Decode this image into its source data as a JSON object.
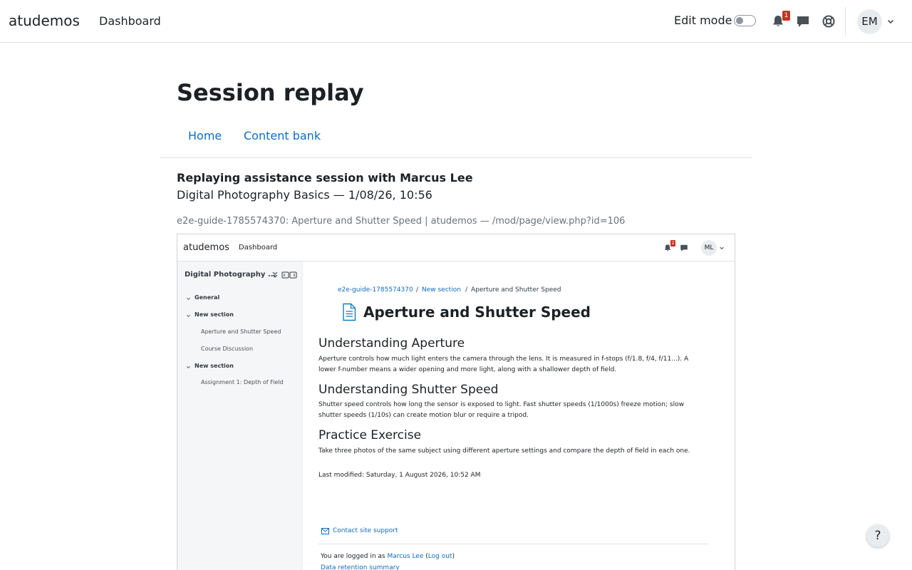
{
  "navbar": {
    "brand": "atudemos",
    "dashboard": "Dashboard",
    "edit_mode_label": "Edit mode",
    "notification_count": "1",
    "avatar_initials": "EM"
  },
  "page": {
    "title": "Session replay",
    "tabs": [
      {
        "label": "Home"
      },
      {
        "label": "Content bank"
      }
    ],
    "replay_heading": "Replaying assistance session with Marcus Lee",
    "replay_subheading": "Digital Photography Basics — 1/08/26, 10:56",
    "frame_caption": "e2e-guide-1785574370: Aperture and Shutter Speed | atudemos — /mod/page/view.php?id=106"
  },
  "frame": {
    "navbar": {
      "brand": "atudemos",
      "dashboard": "Dashboard",
      "notification_count": "2",
      "avatar_initials": "ML"
    },
    "sidebar": {
      "course_title": "Digital Photography ...",
      "sections": [
        {
          "label": "General"
        },
        {
          "label": "New section"
        },
        {
          "label": "New section"
        }
      ],
      "items": [
        {
          "label": "Aperture and Shutter Speed"
        },
        {
          "label": "Course Discussion"
        },
        {
          "label": "Assignment 1: Depth of Field"
        }
      ]
    },
    "breadcrumb": [
      "e2e-guide-1785574370",
      "New section",
      "Aperture and Shutter Speed"
    ],
    "title": "Aperture and Shutter Speed",
    "sections": [
      {
        "heading": "Understanding Aperture",
        "text": "Aperture controls how much light enters the camera through the lens. It is measured in f-stops (f/1.8, f/4, f/11...). A lower f-number means a wider opening and more light, along with a shallower depth of field."
      },
      {
        "heading": "Understanding Shutter Speed",
        "text": "Shutter speed controls how long the sensor is exposed to light. Fast shutter speeds (1/1000s) freeze motion; slow shutter speeds (1/10s) can create motion blur or require a tripod."
      },
      {
        "heading": "Practice Exercise",
        "text": "Take three photos of the same subject using different aperture settings and compare the depth of field in each one."
      }
    ],
    "last_modified": "Last modified: Saturday, 1 August 2026, 10:52 AM",
    "footer": {
      "contact": "Contact site support",
      "logged_prefix": "You are logged in as ",
      "user": "Marcus Lee",
      "logout": "Log out",
      "retention": "Data retention summary"
    }
  },
  "help_button": "?",
  "colors": {
    "link": "#0f6cbf",
    "badge": "#ca3120",
    "text": "#1d2125",
    "sidebar_bg": "#f5f6f7"
  },
  "icons": [
    "bell-icon",
    "chat-icon",
    "lifebuoy-icon",
    "chevron-down-icon",
    "document-icon",
    "mail-icon",
    "collapse-icon",
    "expand-icon"
  ]
}
